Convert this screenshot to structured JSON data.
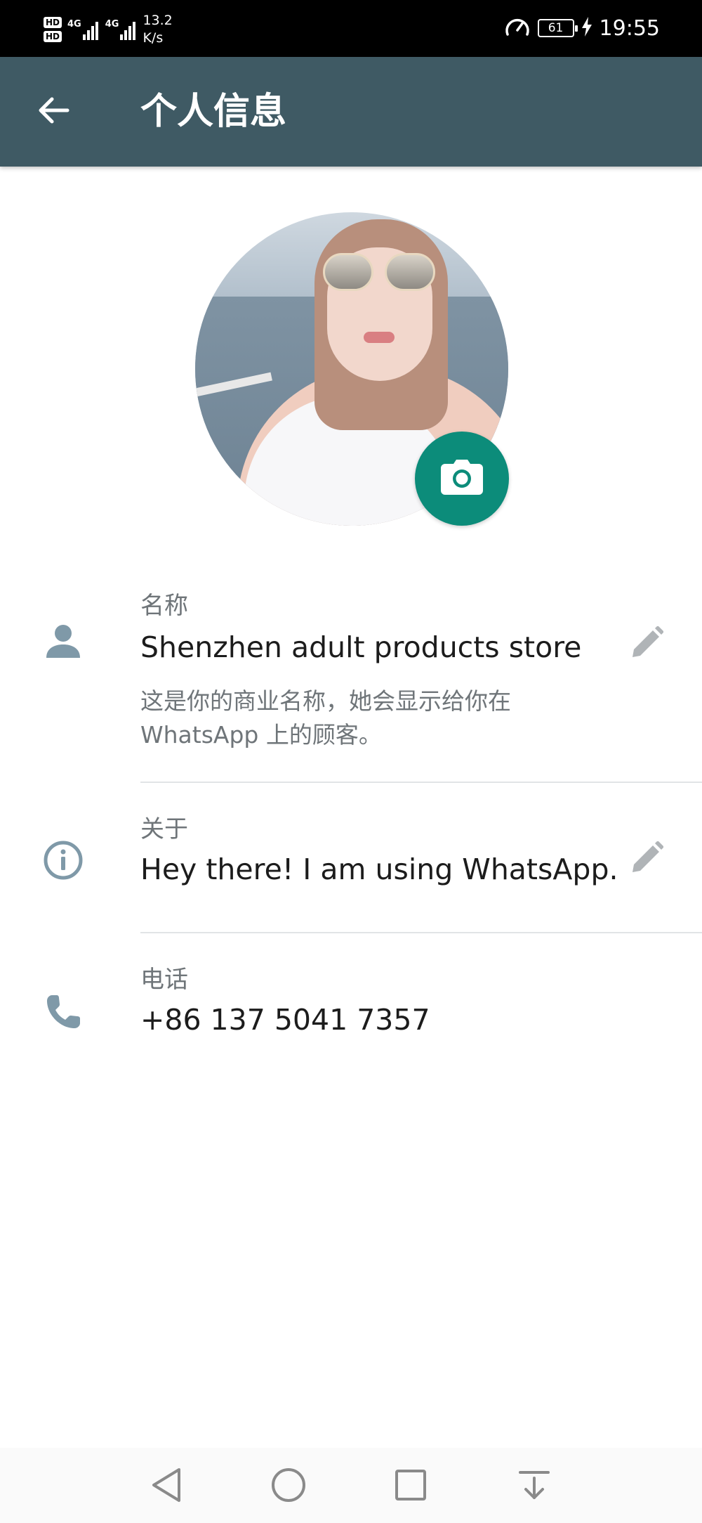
{
  "status_bar": {
    "hd1": "HD",
    "hd2": "HD",
    "sig1_type": "4G",
    "sig2_type": "4G",
    "speed_value": "13.2",
    "speed_unit": "K/s",
    "battery": "61",
    "time": "19:55"
  },
  "app_bar": {
    "title": "个人信息",
    "back_icon": "arrow-left-icon"
  },
  "profile": {
    "camera_icon": "camera-icon"
  },
  "name_row": {
    "label": "名称",
    "value": "Shenzhen adult products store",
    "hint_line1": "这是你的商业名称，她会显示给你在",
    "hint_line2": "WhatsApp 上的顾客。"
  },
  "about_row": {
    "label": "关于",
    "value": "Hey there! I am using WhatsApp."
  },
  "phone_row": {
    "label": "电话",
    "value": "+86 137 5041 7357"
  },
  "colors": {
    "app_bar": "#3f5a64",
    "accent": "#0c8c7a",
    "icon_gray": "#7f99a8"
  },
  "nav_bar": {
    "icons": [
      "back-triangle-icon",
      "home-circle-icon",
      "recents-square-icon",
      "notification-pull-icon"
    ]
  }
}
